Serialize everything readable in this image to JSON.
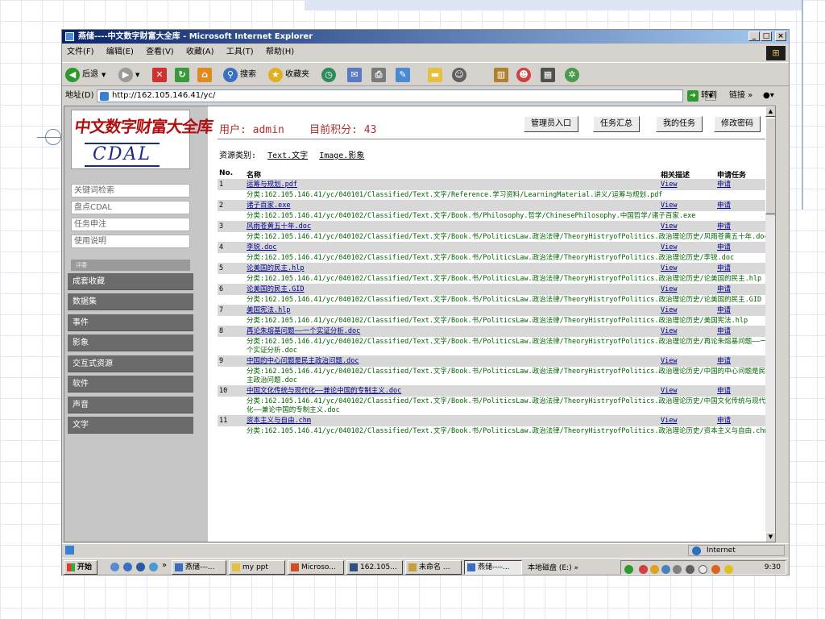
{
  "window": {
    "title": "燕储----中文数字财富大全库 - Microsoft Internet Explorer",
    "controls": [
      "_",
      "□",
      "×"
    ]
  },
  "menu": [
    "文件(F)",
    "编辑(E)",
    "查看(V)",
    "收藏(A)",
    "工具(T)",
    "帮助(H)"
  ],
  "toolbar": {
    "back": "后退",
    "search": "搜索",
    "favorites": "收藏夹"
  },
  "address": {
    "label": "地址(D)",
    "url": "http://162.105.146.41/yc/",
    "go": "转到",
    "links": "链接"
  },
  "logo": {
    "chinese": "中文数字财富大全库",
    "english": "CDAL"
  },
  "sidebar": {
    "light_items": [
      "关键词检索",
      "盘点CDAL",
      "任务申注",
      "使用说明"
    ],
    "tiny_label": "评委",
    "dark_items": [
      "成套收藏",
      "数据集",
      "事件",
      "影象",
      "交互式资源",
      "软件",
      "声音",
      "文字"
    ]
  },
  "header": {
    "user_label": "用户:",
    "user_name": "admin",
    "score_label": "目前积分:",
    "score": "43",
    "buttons": [
      "管理员入口",
      "任务汇总",
      "我的任务",
      "修改密码"
    ]
  },
  "resource_types": {
    "label": "资源类别:",
    "links": [
      "Text.文字",
      "Image.影象"
    ]
  },
  "table": {
    "columns": [
      "No.",
      "名称",
      "相关描述",
      "申请任务"
    ],
    "view_label": "View",
    "apply_label": "申请",
    "rows": [
      {
        "no": "1",
        "name": "运筹与规划.pdf",
        "path": "分类:162.105.146.41/yc/040101/Classified/Text.文字/Reference.学习资料/LearningMaterial.讲义/运筹与规划.pdf"
      },
      {
        "no": "2",
        "name": "诸子百家.exe",
        "path": "分类:162.105.146.41/yc/040102/Classified/Text.文字/Book.书/Philosophy.哲学/ChinesePhilosophy.中国哲学/诸子百家.exe"
      },
      {
        "no": "3",
        "name": "风雨苍黄五十年.doc",
        "path": "分类:162.105.146.41/yc/040102/Classified/Text.文字/Book.书/PoliticsLaw.政治法律/TheoryHistryofPolitics.政治理论历史/风雨苍黄五十年.doc"
      },
      {
        "no": "4",
        "name": "李锐.doc",
        "path": "分类:162.105.146.41/yc/040102/Classified/Text.文字/Book.书/PoliticsLaw.政治法律/TheoryHistryofPolitics.政治理论历史/李锐.doc"
      },
      {
        "no": "5",
        "name": "论美国的民主.hlp",
        "path": "分类:162.105.146.41/yc/040102/Classified/Text.文字/Book.书/PoliticsLaw.政治法律/TheoryHistryofPolitics.政治理论历史/论美国的民主.hlp"
      },
      {
        "no": "6",
        "name": "论美国的民主.GID",
        "path": "分类:162.105.146.41/yc/040102/Classified/Text.文字/Book.书/PoliticsLaw.政治法律/TheoryHistryofPolitics.政治理论历史/论美国的民主.GID"
      },
      {
        "no": "7",
        "name": "美国宪法.hlp",
        "path": "分类:162.105.146.41/yc/040102/Classified/Text.文字/Book.书/PoliticsLaw.政治法律/TheoryHistryofPolitics.政治理论历史/美国宪法.hlp"
      },
      {
        "no": "8",
        "name": "再论朱熔基问题——一个实证分析.doc",
        "path": "分类:162.105.146.41/yc/040102/Classified/Text.文字/Book.书/PoliticsLaw.政治法律/TheoryHistryofPolitics.政治理论历史/再论朱熔基问题——一个实证分析.doc"
      },
      {
        "no": "9",
        "name": "中国的中心问题是民主政治问题.doc",
        "path": "分类:162.105.146.41/yc/040102/Classified/Text.文字/Book.书/PoliticsLaw.政治法律/TheoryHistryofPolitics.政治理论历史/中国的中心问题是民主政治问题.doc"
      },
      {
        "no": "10",
        "name": "中国文化传统与现代化——兼论中国的专制主义.doc",
        "path": "分类:162.105.146.41/yc/040102/Classified/Text.文字/Book.书/PoliticsLaw.政治法律/TheoryHistryofPolitics.政治理论历史/中国文化传统与现代化——兼论中国的专制主义.doc"
      },
      {
        "no": "11",
        "name": "资本主义与自由.chm",
        "path": "分类:162.105.146.41/yc/040102/Classified/Text.文字/Book.书/PoliticsLaw.政治法律/TheoryHistryofPolitics.政治理论历史/资本主义与自由.chm"
      }
    ]
  },
  "status": {
    "zone": "Internet"
  },
  "taskbar": {
    "start": "开始",
    "tasks": [
      "燕储---...",
      "my ppt",
      "Microso...",
      "162.105...",
      "未命名 ...",
      "燕储----...",
      "本地磁盘 (E:)"
    ],
    "clock": "9:30"
  },
  "colors": {
    "title_gradient_start": "#0a246a",
    "user_text": "#b03030",
    "link_blue": "#00008b",
    "path_green": "#006400",
    "sidebar_dark": "#6b6b6b"
  }
}
